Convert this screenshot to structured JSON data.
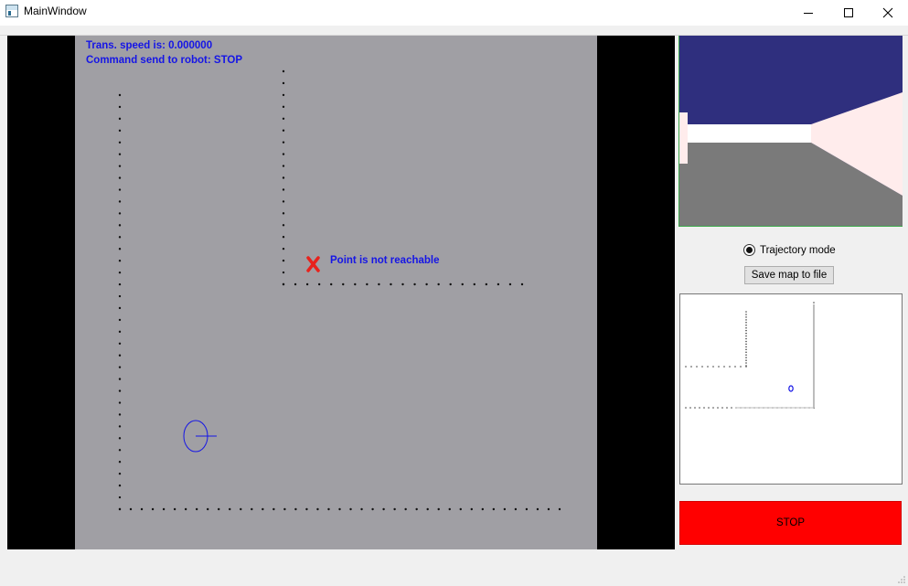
{
  "window": {
    "title": "MainWindow",
    "controls": [
      "minimize",
      "maximize",
      "close"
    ]
  },
  "simulation": {
    "speed_text": "Trans. speed is: 0.000000",
    "command_text": "Command send to robot: STOP",
    "marker_label": "Point is not reachable",
    "colors": {
      "background": "#a09fa4",
      "text": "#1515e6",
      "marker": "#e8221c",
      "robot": "#1515e6"
    }
  },
  "camera": {
    "colors": {
      "ceiling": "#2f2f7e",
      "floor": "#7a7a7a",
      "wall": "#ffecec",
      "far_wall": "#ffffff"
    }
  },
  "controls": {
    "trajectory_mode_label": "Trajectory mode",
    "trajectory_mode_checked": true,
    "save_map_label": "Save map to file",
    "stop_label": "STOP",
    "stop_color": "#ff0000"
  }
}
